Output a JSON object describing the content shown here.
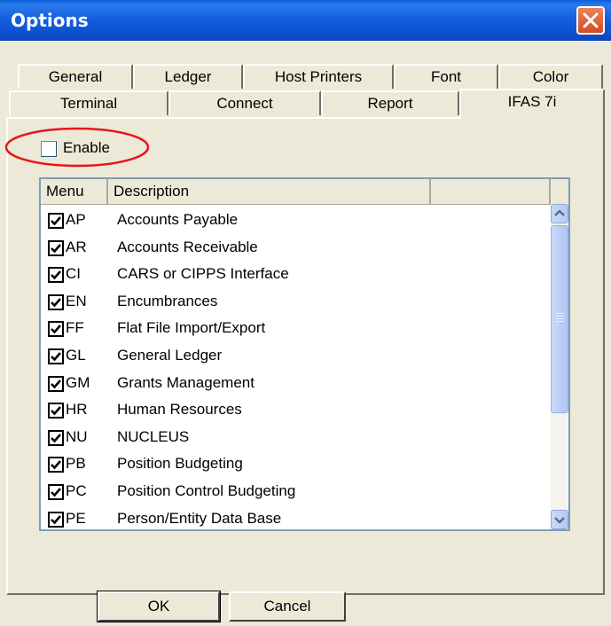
{
  "window": {
    "title": "Options",
    "close_icon": "close-x-icon"
  },
  "tabs_back_row": [
    "General",
    "Ledger",
    "Host Printers",
    "Font",
    "Color"
  ],
  "tabs_front_row": [
    "Terminal",
    "Connect",
    "Report",
    "IFAS 7i"
  ],
  "active_tab": "IFAS 7i",
  "enable": {
    "label": "Enable",
    "checked": false
  },
  "list": {
    "columns": [
      "Menu",
      "Description"
    ],
    "rows": [
      {
        "code": "AP",
        "description": "Accounts Payable",
        "checked": true
      },
      {
        "code": "AR",
        "description": "Accounts Receivable",
        "checked": true
      },
      {
        "code": "CI",
        "description": "CARS or CIPPS Interface",
        "checked": true
      },
      {
        "code": "EN",
        "description": "Encumbrances",
        "checked": true
      },
      {
        "code": "FF",
        "description": "Flat File Import/Export",
        "checked": true
      },
      {
        "code": "GL",
        "description": "General Ledger",
        "checked": true
      },
      {
        "code": "GM",
        "description": "Grants Management",
        "checked": true
      },
      {
        "code": "HR",
        "description": "Human Resources",
        "checked": true
      },
      {
        "code": "NU",
        "description": "NUCLEUS",
        "checked": true
      },
      {
        "code": "PB",
        "description": "Position Budgeting",
        "checked": true
      },
      {
        "code": "PC",
        "description": "Position Control Budgeting",
        "checked": true
      },
      {
        "code": "PE",
        "description": "Person/Entity Data Base",
        "checked": true
      }
    ]
  },
  "buttons": {
    "ok": "OK",
    "cancel": "Cancel"
  },
  "colors": {
    "title_bar": "#0A5FD8",
    "face": "#ECE9D8",
    "highlight_ellipse": "#E8141C",
    "scrollbar": "#C1D3FB"
  }
}
